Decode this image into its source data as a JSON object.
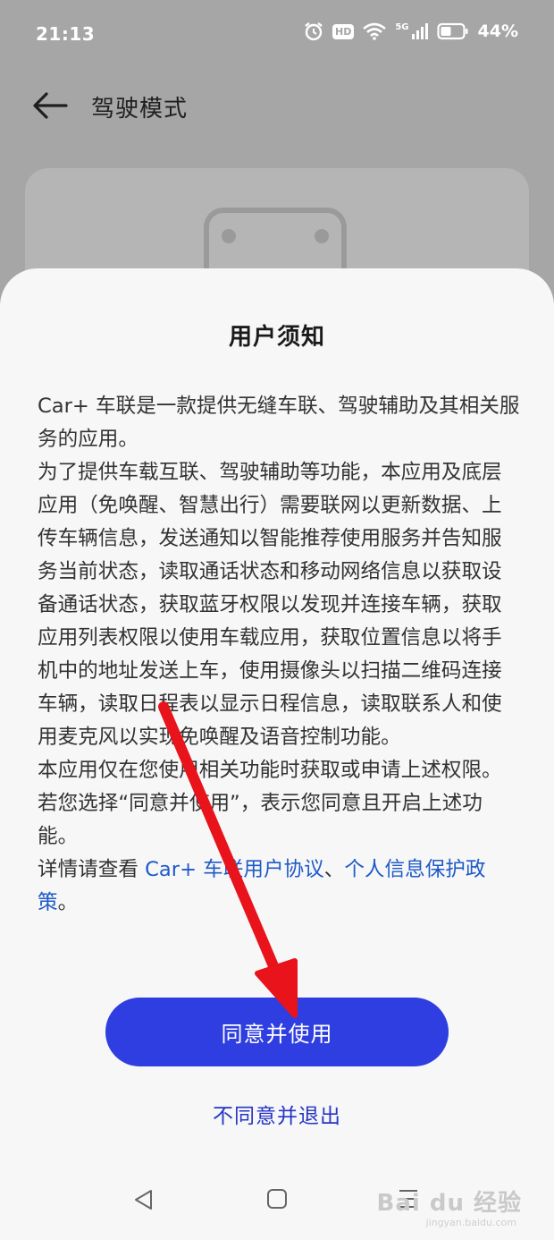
{
  "status_bar": {
    "time": "21:13",
    "battery": "44%",
    "icons": [
      "alarm-icon",
      "hd-icon",
      "wifi-icon",
      "5g-signal-icon",
      "battery-icon"
    ],
    "hd_label": "HD",
    "network_label": "5G"
  },
  "header": {
    "back_icon": "back-arrow-icon",
    "title": "驾驶模式"
  },
  "dialog": {
    "title": "用户须知",
    "paragraphs": [
      "Car+ 车联是一款提供无缝车联、驾驶辅助及其相关服务的应用。",
      "为了提供车载互联、驾驶辅助等功能，本应用及底层应用（免唤醒、智慧出行）需要联网以更新数据、上传车辆信息，发送通知以智能推荐使用服务并告知服务当前状态，读取通话状态和移动网络信息以获取设备通话状态，获取蓝牙权限以发现并连接车辆，获取应用列表权限以使用车载应用，获取位置信息以将手机中的地址发送上车，使用摄像头以扫描二维码连接车辆，读取日程表以显示日程信息，读取联系人和使用麦克风以实现免唤醒及语音控制功能。",
      "本应用仅在您使用相关功能时获取或申请上述权限。若您选择“同意并使用”，表示您同意且开启上述功能。"
    ],
    "details_prefix": "详情请查看 ",
    "link_agreement": "Car+ 车联用户协议",
    "separator": "、",
    "link_privacy": "个人信息保护政策",
    "details_suffix": "。",
    "agree_button": "同意并使用",
    "disagree_button": "不同意并退出"
  },
  "navbar": {
    "icons": [
      "nav-back-icon",
      "nav-home-icon",
      "nav-menu-icon"
    ]
  },
  "watermark": {
    "text": "Bai du 经验",
    "sub": "jingyan.baidu.com"
  },
  "colors": {
    "primary_button": "#2f3ee0",
    "link": "#1f5ac7",
    "annotation_arrow": "#e8131b"
  }
}
